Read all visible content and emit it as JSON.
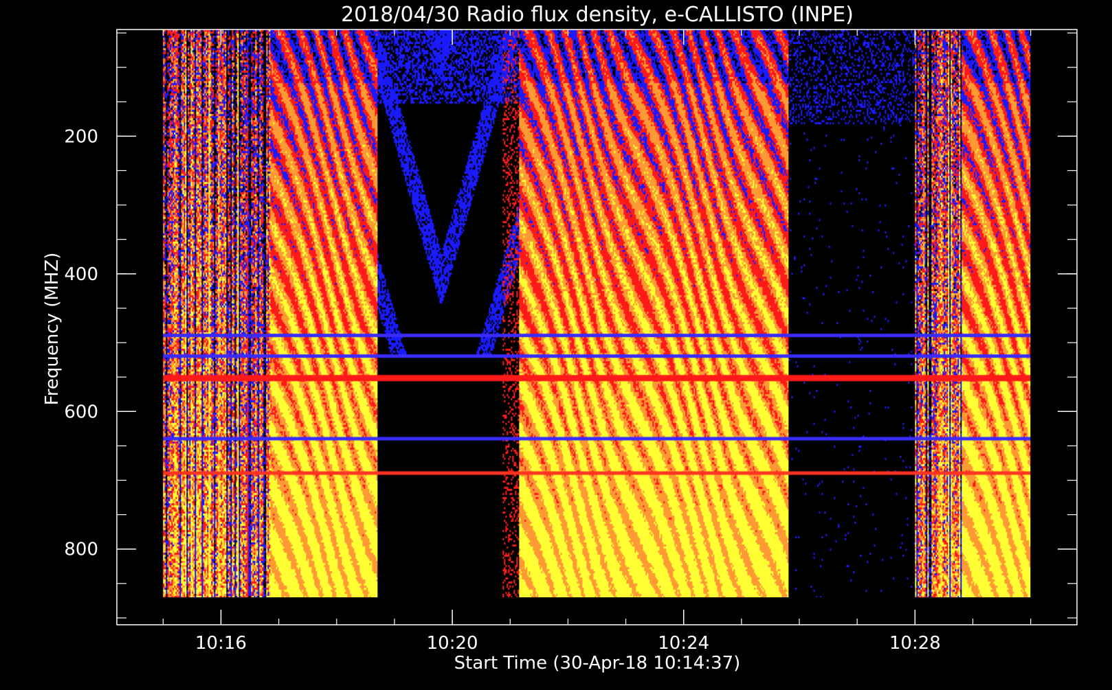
{
  "chart_data": {
    "type": "heatmap",
    "title": "2018/04/30  Radio flux density, e-CALLISTO (INPE)",
    "xlabel": "Start Time (30-Apr-18 10:14:37)",
    "ylabel": "Frequency (MHZ)",
    "x_unit": "minutes of day (10:00 = 600)",
    "xlim": [
      614.2,
      630.8
    ],
    "ylim": [
      45,
      910
    ],
    "y_inverted": true,
    "data_x_range": [
      615.0,
      630.0
    ],
    "data_y_range": [
      45,
      870
    ],
    "x_ticks": [
      {
        "value": 616,
        "label": "10:16"
      },
      {
        "value": 620,
        "label": "10:20"
      },
      {
        "value": 624,
        "label": "10:24"
      },
      {
        "value": 628,
        "label": "10:28"
      }
    ],
    "x_minor_step": 1,
    "y_ticks": [
      {
        "value": 200,
        "label": "200"
      },
      {
        "value": 400,
        "label": "400"
      },
      {
        "value": 600,
        "label": "600"
      },
      {
        "value": 800,
        "label": "800"
      }
    ],
    "y_minor_step": 50,
    "colormap": [
      "#000000",
      "#1a1aff",
      "#ff1a1a",
      "#ff9933",
      "#ffff33"
    ],
    "colormap_name": "black-blue-red-orange-yellow",
    "segments": [
      {
        "t_start": 615.0,
        "t_end": 616.85,
        "pattern": "bursty-noise",
        "level": 0.62
      },
      {
        "t_start": 616.85,
        "t_end": 618.7,
        "pattern": "drifting-stripes",
        "level": 0.8
      },
      {
        "t_start": 618.7,
        "t_end": 621.15,
        "pattern": "quiet-arcs",
        "level": 0.18
      },
      {
        "t_start": 621.15,
        "t_end": 625.8,
        "pattern": "drifting-stripes",
        "level": 0.85
      },
      {
        "t_start": 625.8,
        "t_end": 628.0,
        "pattern": "quiet-sparse",
        "level": 0.12
      },
      {
        "t_start": 628.0,
        "t_end": 628.8,
        "pattern": "bursty-noise",
        "level": 0.55
      },
      {
        "t_start": 628.8,
        "t_end": 630.0,
        "pattern": "drifting-stripes",
        "level": 0.85
      }
    ],
    "rfi_bands_mhz": [
      {
        "freq": 490,
        "color": "#3a2cff"
      },
      {
        "freq": 520,
        "color": "#3a2cff"
      },
      {
        "freq": 550,
        "color": "#ff1a1a"
      },
      {
        "freq": 640,
        "color": "#3a2cff"
      },
      {
        "freq": 690,
        "color": "#ff3322"
      }
    ]
  }
}
